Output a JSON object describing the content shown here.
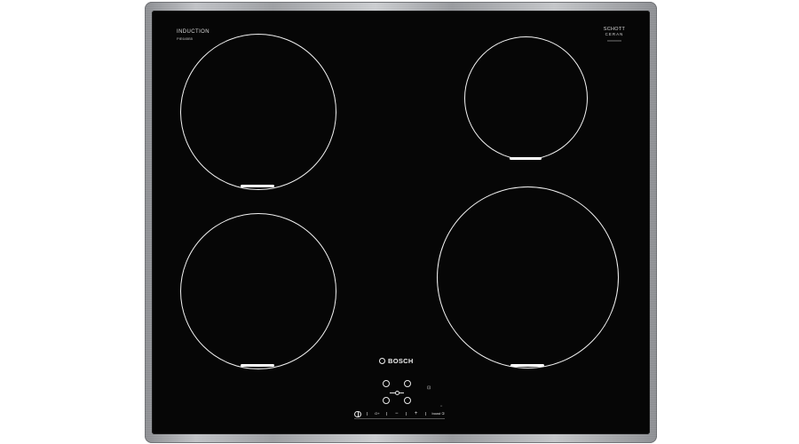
{
  "product": {
    "type_label": "INDUCTION",
    "model_number": "PIE645B5",
    "glass_brand_line1": "SCHOTT",
    "glass_brand_line2": "CERAN",
    "glass_code": "XXXXXXXX",
    "brand_name": "BOSCH"
  },
  "cooking_zones": [
    {
      "name": "rear-left"
    },
    {
      "name": "rear-right"
    },
    {
      "name": "front-left"
    },
    {
      "name": "front-right"
    }
  ],
  "controls": {
    "onoff_symbol": "power",
    "key_lock_label": "O+",
    "minus_label": "−",
    "plus_label": "+",
    "boost_label": "boost ①",
    "timer_symbol": "⊡"
  },
  "colors": {
    "glass": "#060606",
    "frame": "#b0b2b6",
    "print": "#f0f0f0"
  }
}
